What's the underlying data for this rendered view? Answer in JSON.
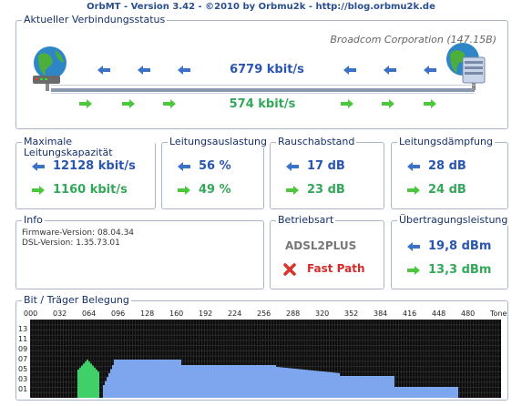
{
  "window": {
    "title": "OrbMT - Version 3.42 - ©2010 by Orbmu2k - http://blog.orbmu2k.de"
  },
  "status": {
    "legend": "Aktueller Verbindungsstatus",
    "chipset": "Broadcom Corporation (147.15B)",
    "down_rate": "6779 kbit/s",
    "up_rate": "574 kbit/s"
  },
  "capacity": {
    "legend": "Maximale Leitungskapazität",
    "down": "12128 kbit/s",
    "up": "1160 kbit/s"
  },
  "utilization": {
    "legend": "Leitungsauslastung",
    "down": "56 %",
    "up": "49 %"
  },
  "snr": {
    "legend": "Rauschabstand",
    "down": "17 dB",
    "up": "23 dB"
  },
  "attenuation": {
    "legend": "Leitungsdämpfung",
    "down": "28 dB",
    "up": "24 dB"
  },
  "info": {
    "legend": "Info",
    "firmware": "Firmware-Version: 08.04.34",
    "dsl": "DSL-Version: 1.35.73.01"
  },
  "mode": {
    "legend": "Betriebsart",
    "protocol": "ADSL2PLUS",
    "path": "Fast Path"
  },
  "power": {
    "legend": "Übertragungsleistung",
    "down": "19,8 dBm",
    "up": "13,3 dBm"
  },
  "bits": {
    "legend": "Bit / Träger Belegung",
    "x_ticks": [
      "000",
      "032",
      "064",
      "096",
      "128",
      "160",
      "192",
      "224",
      "256",
      "288",
      "320",
      "352",
      "384",
      "416",
      "448",
      "480",
      "Tone"
    ],
    "y_ticks": [
      "13",
      "11",
      "09",
      "07",
      "05",
      "03",
      "01"
    ]
  },
  "colors": {
    "down_arrow": "#3a72c8",
    "up_arrow": "#4cc83c",
    "up_bins": "#3fd06a",
    "down_bins": "#7ea6ee",
    "chart_bg": "#0a0a0a"
  },
  "icons": {
    "modem": "globe-modem-icon",
    "server": "globe-server-icon",
    "down": "arrow-left-icon",
    "up": "arrow-right-icon",
    "error": "red-x-icon"
  }
}
